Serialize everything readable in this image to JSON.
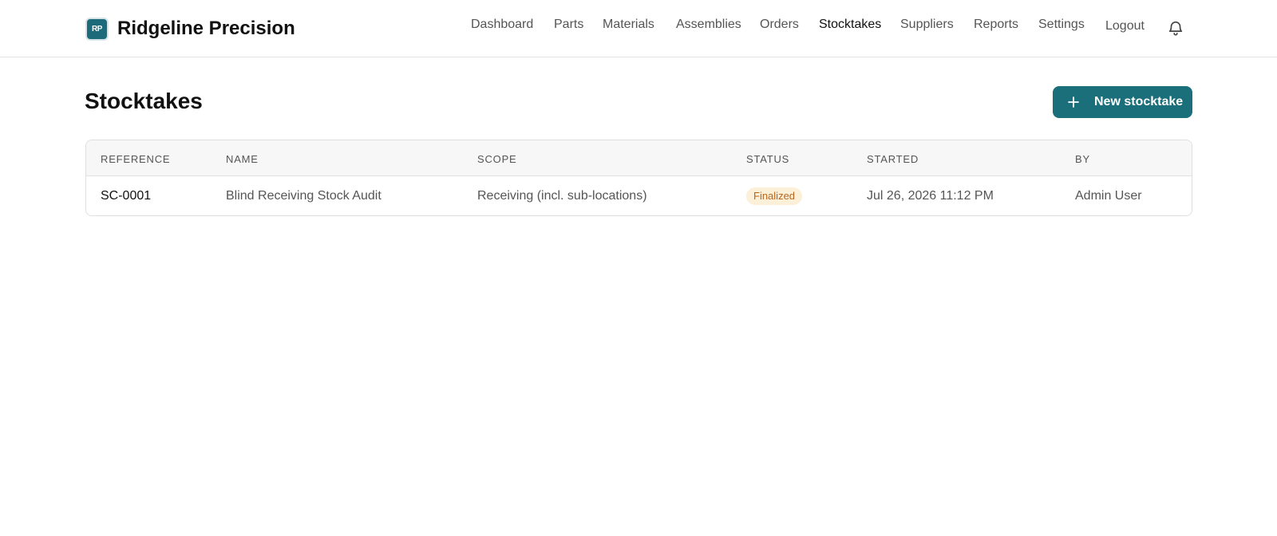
{
  "header": {
    "logo_text": "RP",
    "brand": "Ridgeline Precision",
    "nav": [
      {
        "label": "Dashboard",
        "active": false
      },
      {
        "label": "Parts",
        "active": false
      },
      {
        "label": "Materials",
        "active": false
      },
      {
        "label": "Assemblies",
        "active": false
      },
      {
        "label": "Orders",
        "active": false
      },
      {
        "label": "Stocktakes",
        "active": true
      },
      {
        "label": "Suppliers",
        "active": false
      },
      {
        "label": "Reports",
        "active": false
      },
      {
        "label": "Settings",
        "active": false
      },
      {
        "label": "Logout",
        "active": false
      }
    ],
    "notification_icon": "bell-icon"
  },
  "main": {
    "title": "Stocktakes",
    "new_button_label": "New stocktake",
    "new_button_icon": "plus-icon",
    "table": {
      "columns": [
        "Reference",
        "Name",
        "Scope",
        "Status",
        "Started",
        "By"
      ],
      "rows": [
        {
          "reference": "SC-0001",
          "name": "Blind Receiving Stock Audit",
          "scope": "Receiving (incl. sub-locations)",
          "status": "Finalized",
          "started": "Jul 26, 2026 11:12 PM",
          "by": "Admin User"
        }
      ]
    }
  },
  "colors": {
    "accent": "#1a6f7b",
    "status_finalized_bg": "#fdf0d9",
    "status_finalized_text": "#b8651a"
  }
}
